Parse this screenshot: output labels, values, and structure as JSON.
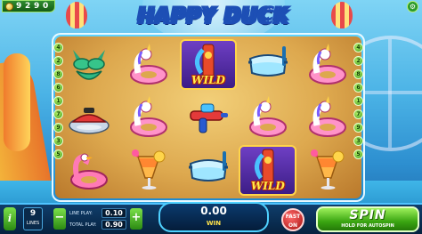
{
  "game": {
    "title": "HAPPY DUCK"
  },
  "balance": {
    "value": "9 2 9 0"
  },
  "reels": [
    [
      "swimsuit",
      "jetski",
      "flamingo-ring"
    ],
    [
      "unicorn-ring",
      "unicorn-ring",
      "cocktail"
    ],
    [
      "wild",
      "water-gun",
      "diving-mask"
    ],
    [
      "diving-mask",
      "unicorn-ring",
      "wild"
    ],
    [
      "unicorn-ring",
      "unicorn-ring",
      "cocktail"
    ]
  ],
  "wild_label": "WILD",
  "paylines_left": [
    "4",
    "2",
    "8",
    "6",
    "1",
    "7",
    "9",
    "3",
    "5"
  ],
  "paylines_right": [
    "4",
    "2",
    "8",
    "6",
    "1",
    "7",
    "9",
    "3",
    "5"
  ],
  "bottom": {
    "info": "i",
    "lines_value": "9",
    "lines_label": "LINES",
    "minus": "−",
    "plus": "+",
    "line_play_label": "LINE PLAY:",
    "line_play_value": "0.10",
    "total_play_label": "TOTAL PLAY:",
    "total_play_value": "0.90",
    "win_value": "0.00",
    "win_label": "WIN",
    "fast_label": "FAST",
    "fast_sub": "ON",
    "spin_label": "SPIN",
    "spin_sub": "HOLD FOR AUTOSPIN"
  },
  "colors": {
    "accent_green": "#3aa612",
    "frame_blue": "#1f8ad0",
    "gold": "#ffe24a"
  }
}
